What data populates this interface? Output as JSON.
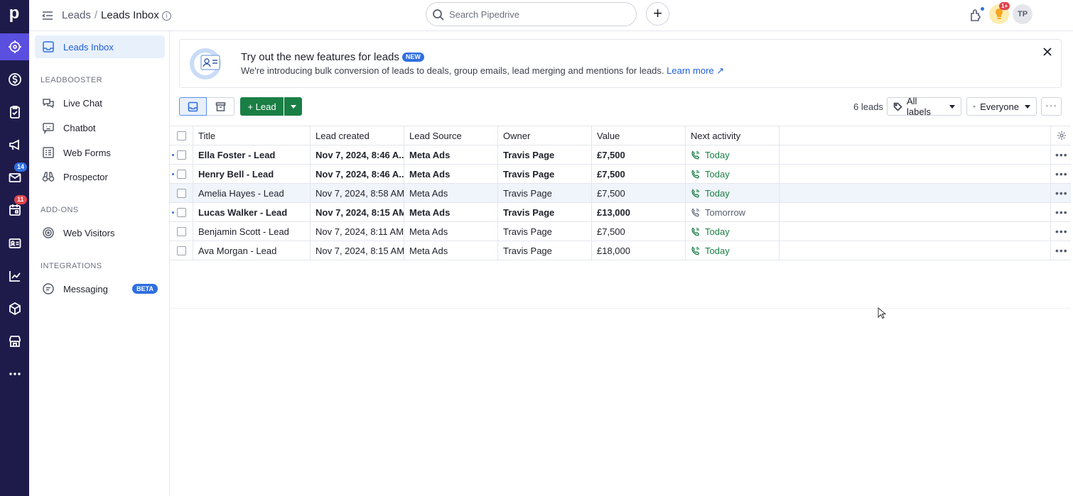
{
  "app": {
    "logo": "p"
  },
  "rail": {
    "mail_badge": "14",
    "calendar_badge": "11"
  },
  "header": {
    "crumb_parent": "Leads",
    "crumb_sep": "/",
    "crumb_current": "Leads Inbox",
    "search_placeholder": "Search Pipedrive",
    "notif_badge": "1+",
    "avatar_initials": "TP"
  },
  "sidebar": {
    "inbox_label": "Leads Inbox",
    "section1": "LEADBOOSTER",
    "live_chat": "Live Chat",
    "chatbot": "Chatbot",
    "web_forms": "Web Forms",
    "prospector": "Prospector",
    "section2": "ADD-ONS",
    "web_visitors": "Web Visitors",
    "section3": "INTEGRATIONS",
    "messaging": "Messaging",
    "beta": "BETA"
  },
  "banner": {
    "title": "Try out the new features for leads",
    "new_badge": "NEW",
    "description": "We're introducing bulk conversion of leads to deals, group emails, lead merging and mentions for leads.",
    "learn_more": "Learn more ↗"
  },
  "toolbar": {
    "lead_button": "+ Lead",
    "count": "6 leads",
    "labels_filter": "All labels",
    "owner_filter": "Everyone",
    "more": "···"
  },
  "table": {
    "columns": [
      "Title",
      "Lead created",
      "Lead Source",
      "Owner",
      "Value",
      "Next activity"
    ],
    "rows": [
      {
        "title": "Ella Foster - Lead",
        "created": "Nov 7, 2024, 8:46 A...",
        "source": "Meta Ads",
        "owner": "Travis Page",
        "value": "£7,500",
        "activity": "Today"
      },
      {
        "title": "Henry Bell - Lead",
        "created": "Nov 7, 2024, 8:46 A...",
        "source": "Meta Ads",
        "owner": "Travis Page",
        "value": "£7,500",
        "activity": "Today"
      },
      {
        "title": "Amelia Hayes - Lead",
        "created": "Nov 7, 2024, 8:58 AM",
        "source": "Meta Ads",
        "owner": "Travis Page",
        "value": "£7,500",
        "activity": "Today"
      },
      {
        "title": "Lucas Walker - Lead",
        "created": "Nov 7, 2024, 8:15 AM",
        "source": "Meta Ads",
        "owner": "Travis Page",
        "value": "£13,000",
        "activity": "Tomorrow"
      },
      {
        "title": "Benjamin Scott - Lead",
        "created": "Nov 7, 2024, 8:11 AM",
        "source": "Meta Ads",
        "owner": "Travis Page",
        "value": "£7,500",
        "activity": "Today"
      },
      {
        "title": "Ava Morgan - Lead",
        "created": "Nov 7, 2024, 8:15 AM",
        "source": "Meta Ads",
        "owner": "Travis Page",
        "value": "£18,000",
        "activity": "Today"
      }
    ]
  },
  "colors": {
    "rail": "#1e1b4b",
    "accent": "#2f6fe0",
    "primary_green": "#1a7f45"
  }
}
